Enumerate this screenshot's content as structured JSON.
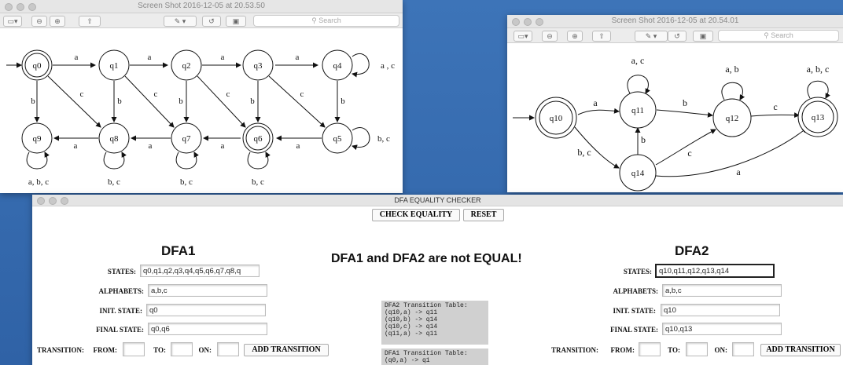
{
  "window1": {
    "title": "Screen Shot 2016-12-05 at 20.53.50",
    "search_placeholder": "Search",
    "states": [
      "q0",
      "q1",
      "q2",
      "q3",
      "q4",
      "q9",
      "q8",
      "q7",
      "q6",
      "q5"
    ],
    "labels": {
      "a": "a",
      "b": "b",
      "c": "c",
      "loop_q4": "a , c",
      "loop_q5": "b, c",
      "loop_q9": "a, b, c",
      "loop_q8": "b, c",
      "loop_q7": "b, c",
      "loop_q6": "b, c"
    }
  },
  "window2": {
    "title": "Screen Shot 2016-12-05 at 20.54.01",
    "search_placeholder": "Search",
    "states": [
      "q10",
      "q11",
      "q12",
      "q13",
      "q14"
    ],
    "labels": {
      "a": "a",
      "b": "b",
      "c": "c",
      "bc": "b, c",
      "loop_q11": "a, c",
      "loop_q12": "a, b",
      "loop_q13": "a, b, c"
    }
  },
  "app": {
    "title": "DFA EQUALITY CHECKER",
    "check_label": "CHECK EQUALITY",
    "reset_label": "RESET",
    "result": "DFA1 and DFA2 are not EQUAL!",
    "dfa1": {
      "heading": "DFA1",
      "states_label": "STATES:",
      "states_value": "q0,q1,q2,q3,q4,q5,q6,q7,q8,q",
      "alphabets_label": "ALPHABETS:",
      "alphabets_value": "a,b,c",
      "init_label": "INIT. STATE:",
      "init_value": "q0",
      "final_label": "FINAL STATE:",
      "final_value": "q0,q6",
      "transition_label": "TRANSITION:",
      "from_label": "FROM:",
      "to_label": "TO:",
      "on_label": "ON:",
      "add_label": "ADD TRANSITION"
    },
    "dfa2": {
      "heading": "DFA2",
      "states_label": "STATES:",
      "states_value": "q10,q11,q12,q13,q14",
      "alphabets_label": "ALPHABETS:",
      "alphabets_value": "a,b,c",
      "init_label": "INIT. STATE:",
      "init_value": "q10",
      "final_label": "FINAL STATE:",
      "final_value": "q10,q13",
      "transition_label": "TRANSITION:",
      "from_label": "FROM:",
      "to_label": "TO:",
      "on_label": "ON:",
      "add_label": "ADD TRANSITION"
    },
    "table2_text": "DFA2 Transition Table:\n(q10,a) -> q11\n(q10,b) -> q14\n(q10,c) -> q14\n(q11,a) -> q11",
    "table1_text": "DFA1 Transition Table:\n(q0,a) -> q1"
  }
}
